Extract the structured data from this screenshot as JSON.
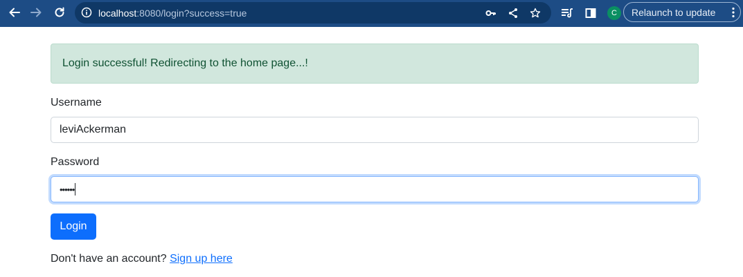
{
  "browser": {
    "url_host": "localhost",
    "url_rest": ":8080/login?success=true",
    "avatar_letter": "C",
    "relaunch_label": "Relaunch to update",
    "icons": [
      "back-arrow-icon",
      "forward-arrow-icon",
      "reload-icon",
      "info-icon",
      "key-icon",
      "share-icon",
      "star-icon",
      "reading-list-icon",
      "side-panel-icon",
      "more-vert-icon"
    ],
    "colors": {
      "toolbar": "#1d4c85",
      "omnibox": "#0f3866",
      "avatar": "#0a8f62"
    }
  },
  "alert": {
    "message": "Login successful! Redirecting to the home page...!",
    "colors": {
      "bg": "#d1e7dd",
      "text": "#0f5132"
    }
  },
  "form": {
    "username_label": "Username",
    "username_value": "leviAckerman",
    "password_label": "Password",
    "password_value": "••••••",
    "login_button": "Login",
    "accent": "#0d6efd"
  },
  "footer": {
    "signup_prompt": "Don't have an account?",
    "signup_link": "Sign up here"
  }
}
